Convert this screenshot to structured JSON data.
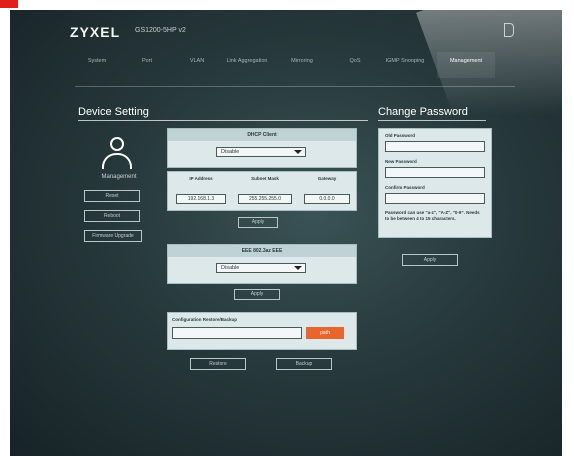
{
  "brand": {
    "logo": "ZYXEL",
    "model": "GS1200-5HP v2"
  },
  "nav": {
    "items": [
      {
        "label": "System"
      },
      {
        "label": "Port"
      },
      {
        "label": "VLAN"
      },
      {
        "label": "Link Aggregation"
      },
      {
        "label": "Mirroring"
      },
      {
        "label": "QoS"
      },
      {
        "label": "IGMP Snooping"
      },
      {
        "label": "Management"
      }
    ],
    "active": "Management"
  },
  "device_setting": {
    "title": "Device Setting",
    "user_label": "Management",
    "buttons": {
      "reset": "Reset",
      "reboot": "Reboot",
      "firmware": "Firmware Upgrade"
    },
    "dhcp": {
      "title": "DHCP Client",
      "value": "Disable"
    },
    "ip": {
      "headers": {
        "ip": "IP Address",
        "mask": "Subnet Mask",
        "gateway": "Gateway"
      },
      "values": {
        "ip": "192.168.1.3",
        "mask": "255.255.255.0",
        "gateway": "0.0.0.0"
      },
      "apply": "Apply"
    },
    "eee": {
      "title": "EEE 802.3az EEE",
      "value": "Disable",
      "apply": "Apply"
    },
    "config": {
      "title": "Configuration Restore/Backup",
      "path_button": "path",
      "restore": "Restore",
      "backup": "Backup"
    }
  },
  "change_password": {
    "title": "Change Password",
    "old_label": "Old Password",
    "new_label": "New Password",
    "confirm_label": "Confirm Password",
    "note": "Password can use \"a-z\", \"A-Z\", \"0-9\". Needs to be between 4 to 15 characters.",
    "apply": "Apply"
  }
}
